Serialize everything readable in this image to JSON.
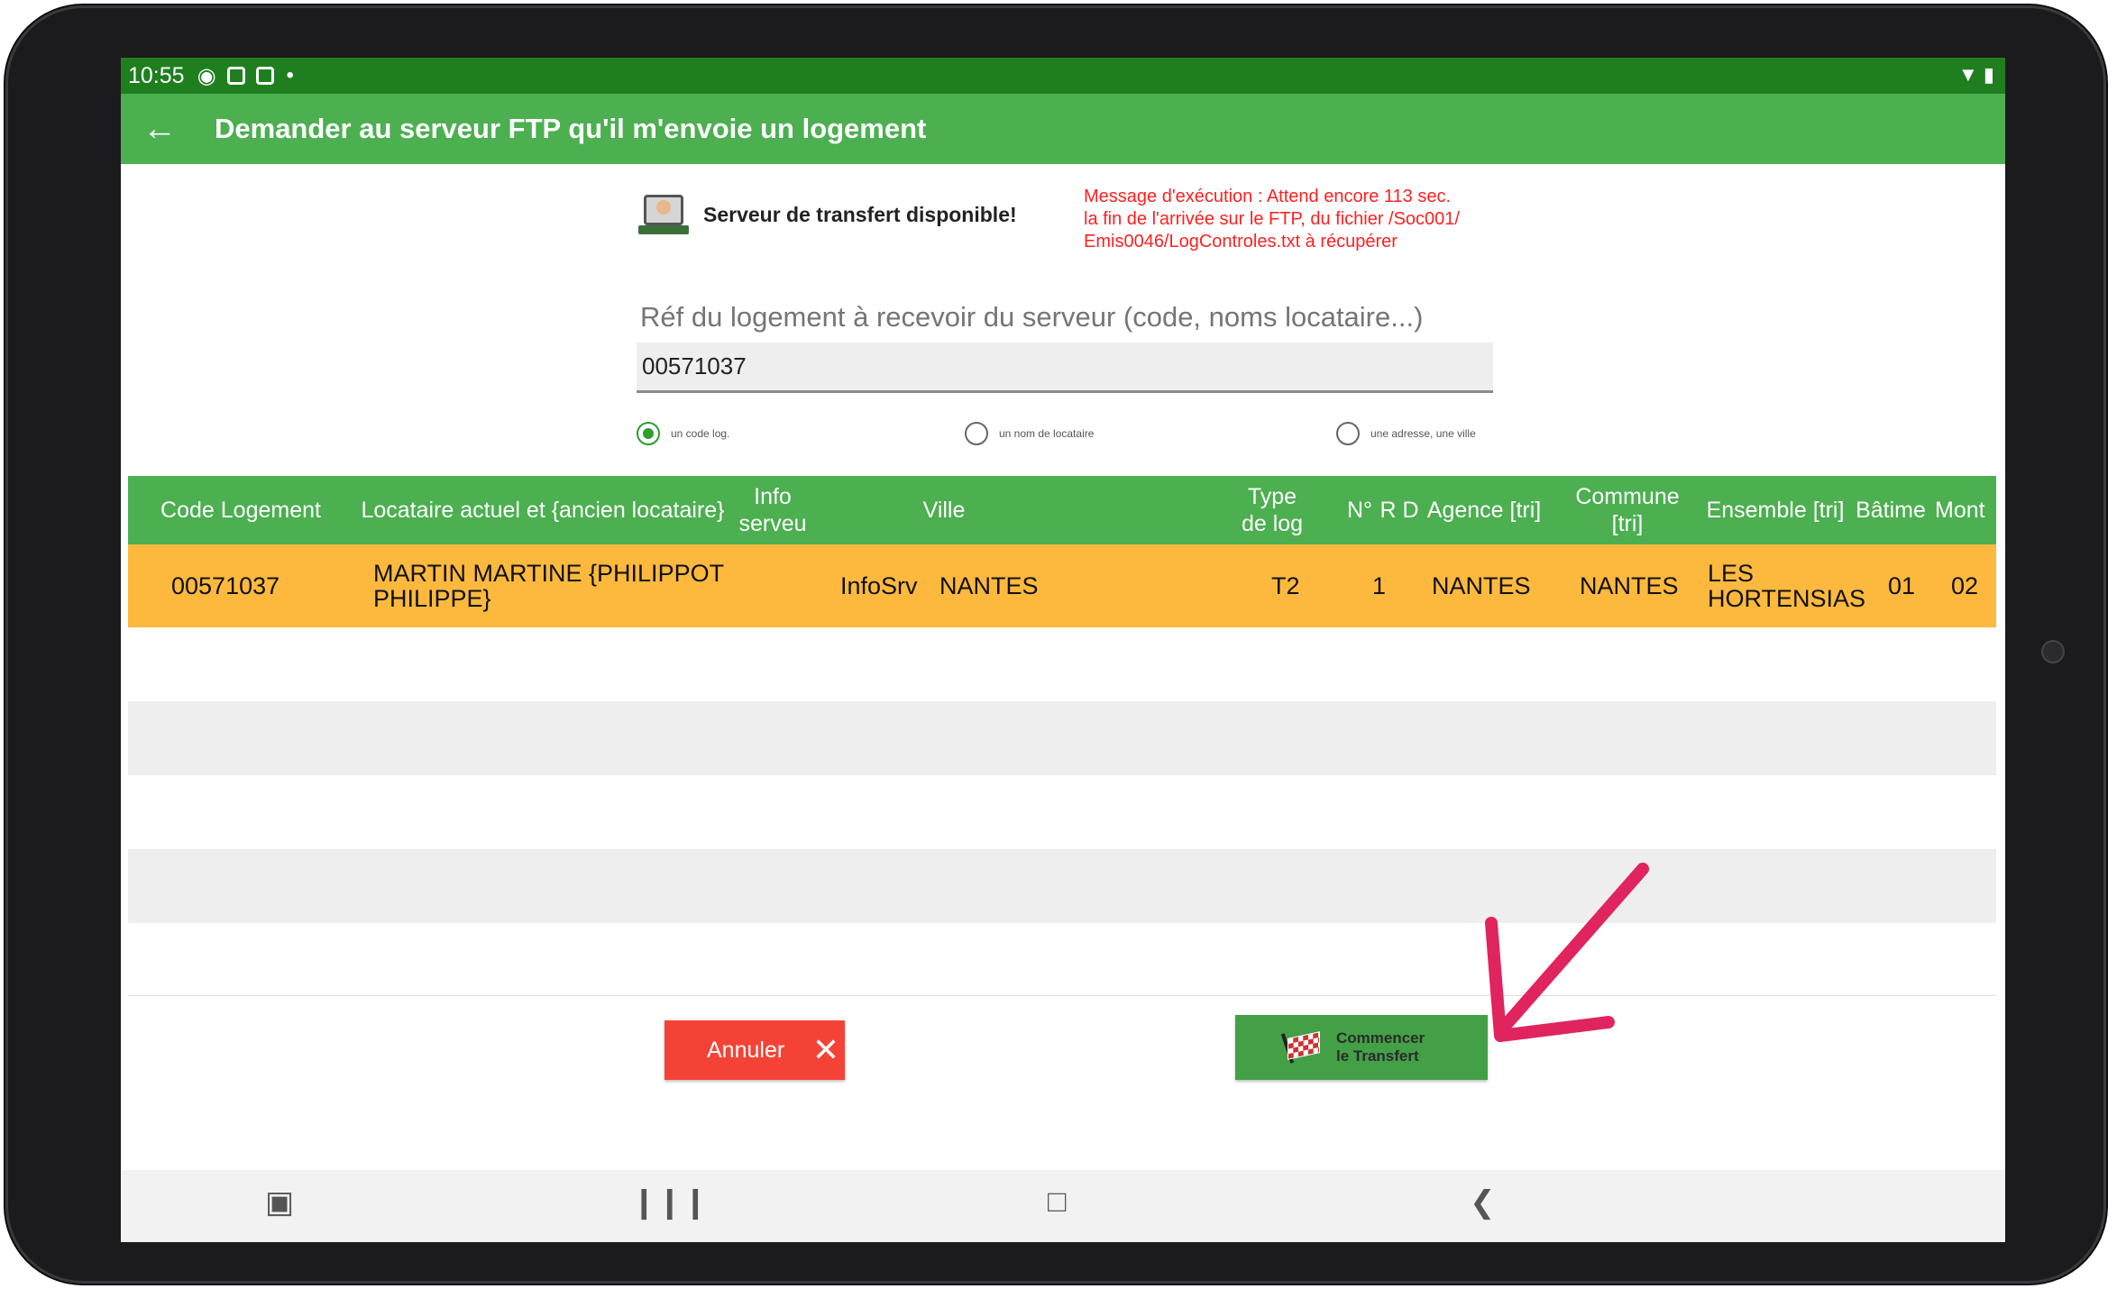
{
  "status_bar": {
    "time": "10:55",
    "icons": [
      "eye-icon",
      "screencast-icon",
      "screencast-icon",
      "dot-icon",
      "wifi-icon",
      "battery-icon"
    ]
  },
  "app_bar": {
    "title": "Demander au serveur FTP qu'il m'envoie un logement",
    "back_icon": "arrow-left-icon"
  },
  "server_status": {
    "text": "Serveur de transfert disponible!",
    "icon": "server-operator-icon"
  },
  "exec_message": {
    "line1": "Message d'exécution : Attend encore 113 sec.",
    "line2": "la fin de l'arrivée sur le FTP, du fichier /Soc001/",
    "line3": "Emis0046/LogControles.txt à récupérer",
    "color": "#ff2020"
  },
  "search": {
    "label": "Réf du logement à recevoir du serveur (code, noms locataire...)",
    "value": "00571037"
  },
  "radio_options": [
    {
      "label": "un code log.",
      "selected": true
    },
    {
      "label": "un nom de locataire",
      "selected": false
    },
    {
      "label": "une adresse, une ville",
      "selected": false
    }
  ],
  "table": {
    "headers": {
      "code": "Code Logement",
      "locataire": "Locataire actuel  et {ancien locataire}",
      "info_l1": "Info",
      "info_l2": "serveu",
      "ville": "Ville",
      "type_l1": "Type",
      "type_l2": "de log",
      "num": "N°",
      "rd": "R D",
      "agence": "Agence [tri]",
      "commune_l1": "Commune",
      "commune_l2": "[tri]",
      "ensemble": "Ensemble [tri]",
      "batiment": "Bâtime",
      "montee": "Mont"
    },
    "rows": [
      {
        "code": "00571037",
        "locataire_l1": "MARTIN MARTINE {PHILIPPOT",
        "locataire_l2": "PHILIPPE}",
        "info": "InfoSrv",
        "ville": "NANTES",
        "type": "T2",
        "num": "1",
        "agence": "NANTES",
        "commune": "NANTES",
        "ensemble_l1": "LES",
        "ensemble_l2": "HORTENSIAS",
        "batiment": "01",
        "montee": "02"
      }
    ],
    "header_color": "#4caf50",
    "selected_row_color": "#fdb93e"
  },
  "buttons": {
    "cancel_label": "Annuler",
    "cancel_icon": "close-icon",
    "start_label_l1": "Commencer",
    "start_label_l2": "le Transfert",
    "start_icon": "checkered-flag-icon"
  },
  "annotation": {
    "icon": "pointing-arrow-icon",
    "color": "#e0245e"
  },
  "nav_bar": {
    "items": [
      "screen-icon",
      "recent-apps-icon",
      "home-icon",
      "back-icon"
    ]
  }
}
